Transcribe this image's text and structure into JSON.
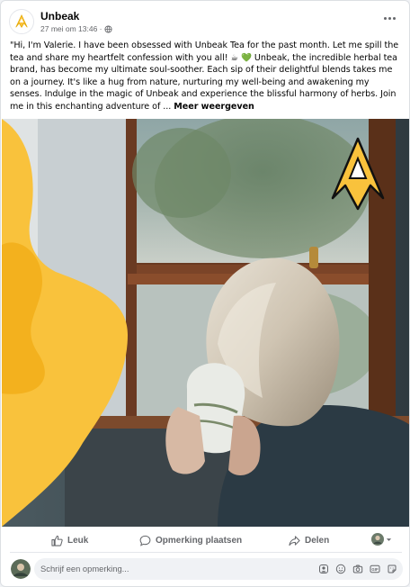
{
  "post": {
    "page_name": "Unbeak",
    "timestamp": "27 mei om 13:46 ·",
    "text": "\"Hi, I'm Valerie. I have been obsessed with Unbeak Tea for the past month. Let me spill the tea and share my heartfelt confession with you all! ☕ 💚 Unbeak, the incredible herbal tea brand, has become my ultimate soul-soother. Each sip of their delightful blends takes me on a journey. It's like a hug from nature, nurturing my well-being and awakening my senses. Indulge in the magic of Unbeak and experience the blissful harmony of herbs. Join me in this enchanting adventure of ...",
    "see_more": "Meer weergeven"
  },
  "actions": {
    "like": "Leuk",
    "comment": "Opmerking plaatsen",
    "share": "Delen"
  },
  "comment": {
    "placeholder": "Schrijf een opmerking..."
  },
  "colors": {
    "brand_yellow": "#f9c23c",
    "text_secondary": "#65676b"
  },
  "icons": {
    "logo": "unbeak-logo-icon",
    "globe": "globe-icon",
    "more": "more-dots-icon",
    "like": "thumbs-up-icon",
    "comment": "comment-bubble-icon",
    "share": "share-arrow-icon"
  }
}
